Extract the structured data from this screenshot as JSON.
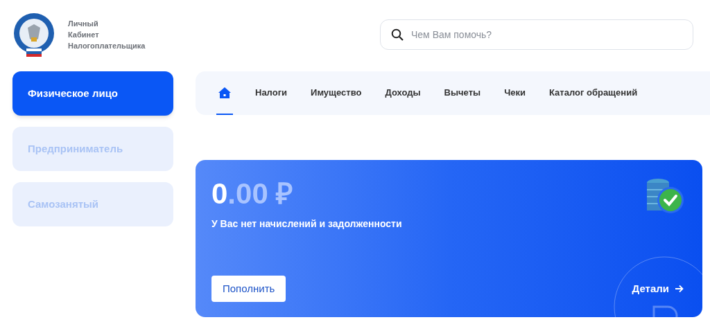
{
  "header": {
    "title_lines": [
      "Личный",
      "Кабинет",
      "Налогоплательщика"
    ],
    "search": {
      "placeholder": "Чем Вам помочь?"
    }
  },
  "sidebar": {
    "items": [
      {
        "label": "Физическое лицо",
        "selected": true
      },
      {
        "label": "Предприниматель",
        "selected": false
      },
      {
        "label": "Самозанятый",
        "selected": false
      }
    ]
  },
  "tabs": [
    {
      "kind": "home",
      "selected": true
    },
    {
      "kind": "text",
      "label": "Налоги",
      "selected": false
    },
    {
      "kind": "text",
      "label": "Имущество",
      "selected": false
    },
    {
      "kind": "text",
      "label": "Доходы",
      "selected": false
    },
    {
      "kind": "text",
      "label": "Вычеты",
      "selected": false
    },
    {
      "kind": "text",
      "label": "Чеки",
      "selected": false
    },
    {
      "kind": "text",
      "label": "Каталог обращений",
      "selected": false
    }
  ],
  "balance": {
    "amount_integer": "0",
    "amount_rest": ".00 ₽",
    "message": "У Вас нет начислений и задолженности",
    "button": "Пополнить",
    "link": "Детали"
  }
}
